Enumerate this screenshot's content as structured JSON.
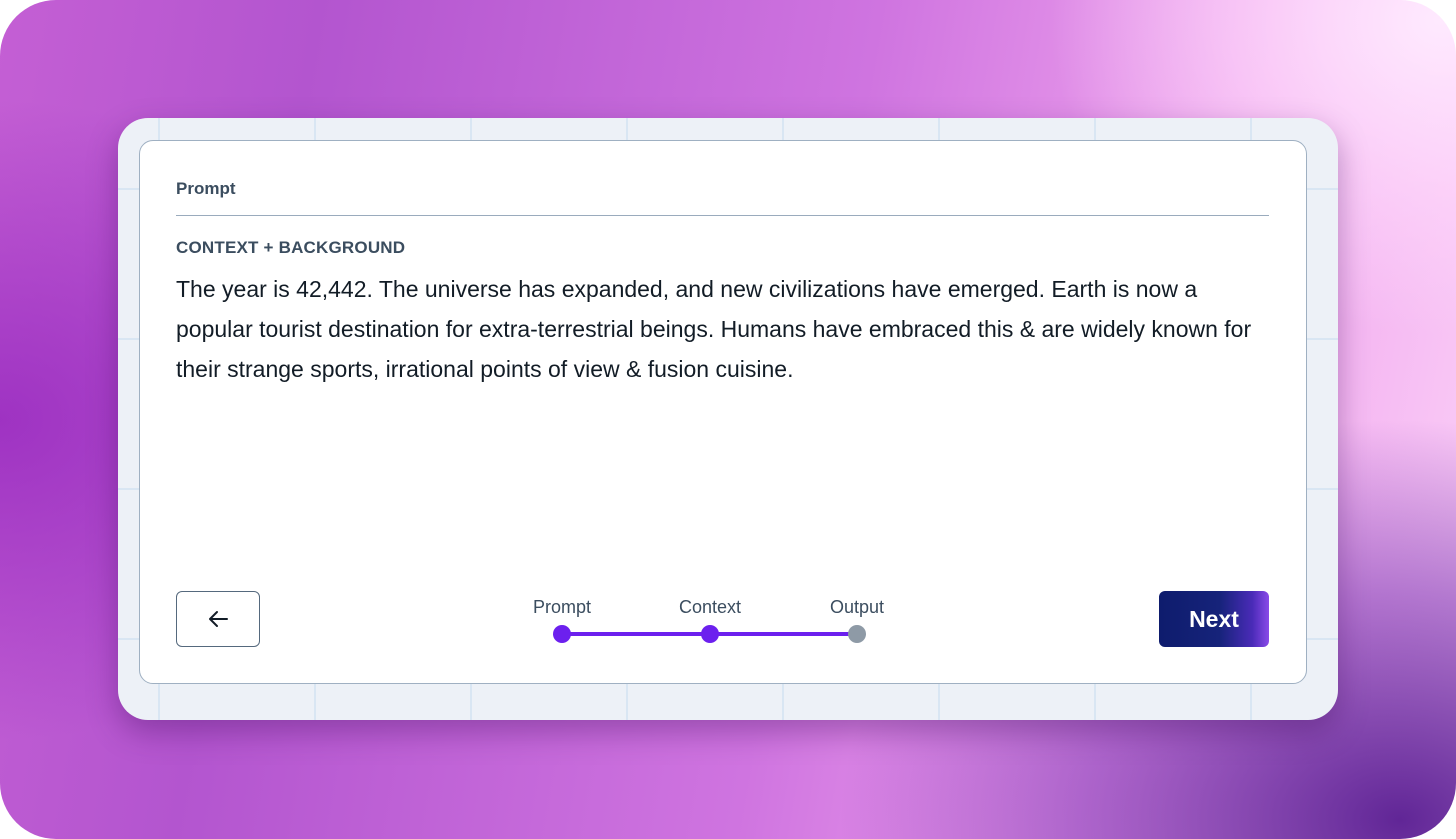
{
  "panel": {
    "title": "Prompt"
  },
  "context": {
    "heading": "CONTEXT + BACKGROUND",
    "body": "The year is 42,442. The universe has expanded, and new civilizations have emerged. Earth is now a popular tourist destination for extra-terrestrial beings. Humans have embraced this & are widely known for their strange sports, irrational points of view & fusion cuisine."
  },
  "navigation": {
    "back_icon": "arrow-left-icon",
    "next_label": "Next"
  },
  "stepper": {
    "current_index": 1,
    "steps": [
      {
        "label": "Prompt",
        "state": "complete"
      },
      {
        "label": "Context",
        "state": "current"
      },
      {
        "label": "Output",
        "state": "upcoming"
      }
    ]
  },
  "colors": {
    "accent": "#6c20ee",
    "inactive": "#8e9aa6",
    "next_button_start": "#0e1c6d",
    "next_button_end": "#8a4ae8",
    "text_heading": "#3b4d5f",
    "text_body": "#121c26"
  }
}
